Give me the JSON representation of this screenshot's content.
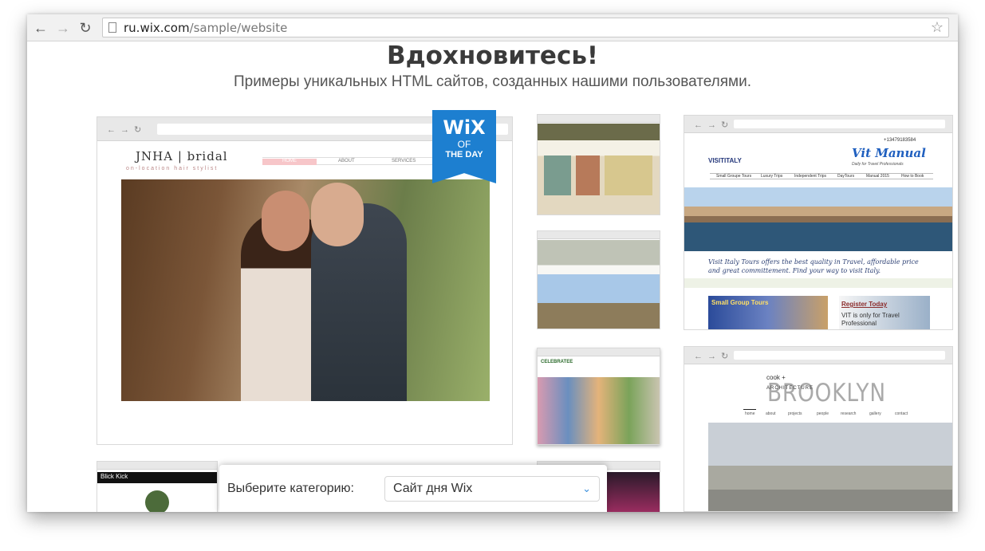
{
  "browser": {
    "url_host": "ru.wix.com",
    "url_path": "/sample/website",
    "back_icon": "back-arrow-icon",
    "forward_icon": "forward-arrow-icon",
    "reload_icon": "reload-icon",
    "bookmark_icon": "star-icon"
  },
  "page": {
    "title": "Вдохновитесь!",
    "subtitle": "Примеры уникальных HTML сайтов, созданных нашими пользователями."
  },
  "badge": {
    "line1": "WiX",
    "line2": "OF",
    "line3": "THE DAY",
    "color": "#1d7fd0"
  },
  "featured_site": {
    "brand": "JNHA | bridal",
    "tagline": "on-location hair stylist",
    "nav": [
      "HOME",
      "ABOUT",
      "SERVICES"
    ]
  },
  "vit_site": {
    "logo": "VISITITALY",
    "name": "Vit Manual",
    "sub": "Daily for Travel Professionals",
    "phone": "+13479183584",
    "menu": [
      "Small Groupe Tours",
      "Luxury Trips",
      "Independent Trips",
      "DayTours",
      "Manual 2015",
      "How to Book"
    ],
    "text": "Visit Italy Tours offers the best quality in Travel, affordable price and great committement. Find your way to visit Italy.",
    "promo1": "Small Group Tours",
    "promo2_title": "Register Today",
    "promo2_text": "VIT is only for Travel Professional"
  },
  "brooklyn_site": {
    "small": "cook +",
    "big": "BROOKLYN",
    "arch": "ARCHITECTURE",
    "nav": [
      "home",
      "about",
      "projects",
      "people",
      "research",
      "gallery",
      "contact"
    ]
  },
  "thumbs": {
    "celebratee": "CELEBRATEE",
    "blick": "Blick Kick"
  },
  "category": {
    "label": "Выберите категорию:",
    "selected": "Сайт дня Wix",
    "chevron_icon": "chevron-down-icon",
    "accent": "#3a8fdc"
  }
}
